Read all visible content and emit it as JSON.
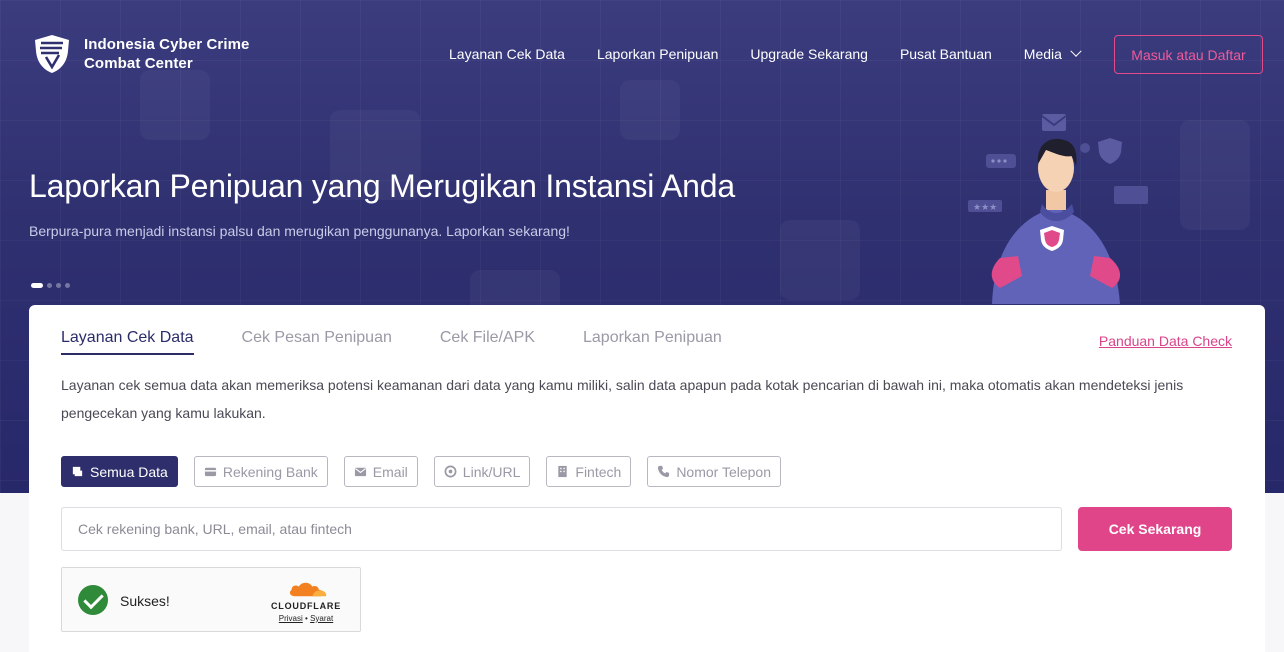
{
  "brand": {
    "name_line1": "Indonesia Cyber Crime",
    "name_line2": "Combat Center"
  },
  "nav": {
    "items": [
      {
        "label": "Layanan Cek Data"
      },
      {
        "label": "Laporkan Penipuan"
      },
      {
        "label": "Upgrade Sekarang"
      },
      {
        "label": "Pusat Bantuan"
      },
      {
        "label": "Media"
      }
    ],
    "login_label": "Masuk atau Daftar"
  },
  "hero": {
    "title": "Laporkan Penipuan yang Merugikan Instansi Anda",
    "subtitle": "Berpura-pura menjadi instansi palsu dan merugikan penggunanya. Laporkan sekarang!",
    "slide_count": 4,
    "active_slide": 1
  },
  "card": {
    "tabs": [
      {
        "label": "Layanan Cek Data",
        "active": true
      },
      {
        "label": "Cek Pesan Penipuan",
        "active": false
      },
      {
        "label": "Cek File/APK",
        "active": false
      },
      {
        "label": "Laporkan Penipuan",
        "active": false
      }
    ],
    "guide_link": "Panduan Data Check",
    "description": "Layanan cek semua data akan memeriksa potensi keamanan dari data yang kamu miliki, salin data apapun pada kotak pencarian di bawah ini, maka otomatis akan mendeteksi jenis pengecekan yang kamu lakukan.",
    "chips": [
      {
        "label": "Semua Data",
        "icon": "all-data-icon",
        "active": true
      },
      {
        "label": "Rekening Bank",
        "icon": "bank-card-icon",
        "active": false
      },
      {
        "label": "Email",
        "icon": "email-icon",
        "active": false
      },
      {
        "label": "Link/URL",
        "icon": "link-icon",
        "active": false
      },
      {
        "label": "Fintech",
        "icon": "building-icon",
        "active": false
      },
      {
        "label": "Nomor Telepon",
        "icon": "phone-icon",
        "active": false
      }
    ],
    "search": {
      "placeholder": "Cek rekening bank, URL, email, atau fintech",
      "value": ""
    },
    "submit_label": "Cek Sekarang"
  },
  "captcha": {
    "status": "Sukses!",
    "provider": "CLOUDFLARE",
    "privacy_link": "Privasi",
    "separator": "•",
    "terms_link": "Syarat"
  },
  "colors": {
    "hero_bg": "#2f3070",
    "accent": "#e0458a",
    "active_chip": "#2d2e6b",
    "success": "#2f8a3a"
  }
}
